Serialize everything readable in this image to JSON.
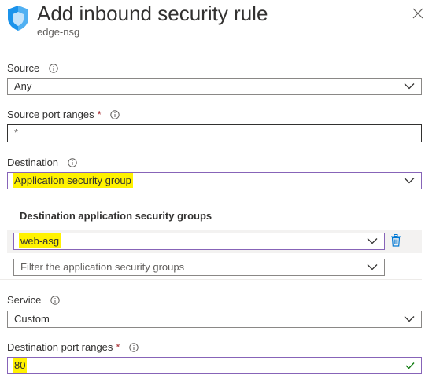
{
  "header": {
    "title": "Add inbound security rule",
    "subtitle": "edge-nsg"
  },
  "fields": {
    "source": {
      "label": "Source",
      "value": "Any"
    },
    "source_port_ranges": {
      "label": "Source port ranges",
      "required_mark": "*",
      "value": "*"
    },
    "destination": {
      "label": "Destination",
      "value": "Application security group"
    },
    "destination_asg": {
      "section_title": "Destination application security groups",
      "selected": "web-asg",
      "filter_placeholder": "Filter the application security groups"
    },
    "service": {
      "label": "Service",
      "value": "Custom"
    },
    "destination_port_ranges": {
      "label": "Destination port ranges",
      "required_mark": "*",
      "value": "80"
    }
  },
  "colors": {
    "accent_focus": "#8764b8",
    "highlight": "#fff200",
    "required": "#a4262c",
    "valid_check": "#107c10",
    "link_blue": "#0078d4"
  },
  "icons": [
    "shield-icon",
    "close-icon",
    "info-icon",
    "chevron-down-icon",
    "delete-icon",
    "checkmark-icon"
  ]
}
